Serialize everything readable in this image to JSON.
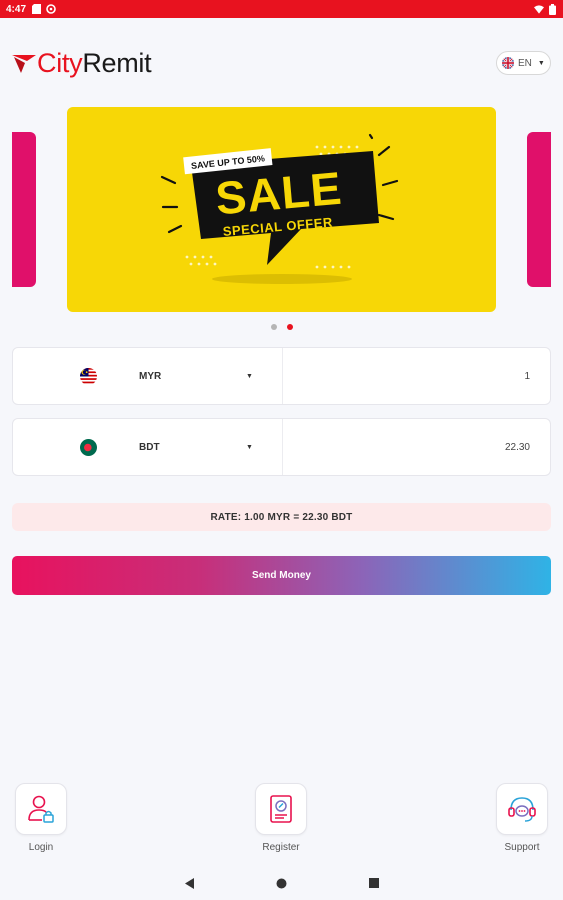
{
  "status_bar": {
    "time": "4:47",
    "icons": [
      "sd-card-icon",
      "sync-icon",
      "wifi-icon",
      "battery-icon"
    ]
  },
  "header": {
    "logo_city": "City",
    "logo_remit": "Remit",
    "language": "EN"
  },
  "carousel": {
    "banner": {
      "tag": "SAVE UP TO 50%",
      "headline": "SALE",
      "subline": "SPECIAL OFFER"
    },
    "dot_count": 2,
    "active_dot": 2
  },
  "converter": {
    "from": {
      "currency": "MYR",
      "amount": "1",
      "flag": "malaysia-flag-icon"
    },
    "to": {
      "currency": "BDT",
      "amount": "22.30",
      "flag": "bangladesh-flag-icon"
    },
    "rate_text": "RATE: 1.00 MYR = 22.30 BDT"
  },
  "send_button": "Send Money",
  "actions": [
    {
      "label": "Login",
      "icon": "user-lock-icon"
    },
    {
      "label": "Register",
      "icon": "register-document-icon"
    },
    {
      "label": "Support",
      "icon": "support-headset-icon"
    }
  ],
  "colors": {
    "brand_red": "#e8121f",
    "banner_yellow": "#f7d706",
    "side_card_pink": "#e0106a",
    "gradient_start": "#e8125e",
    "gradient_end": "#2fb3e6",
    "rate_bg": "#fde9ea"
  }
}
